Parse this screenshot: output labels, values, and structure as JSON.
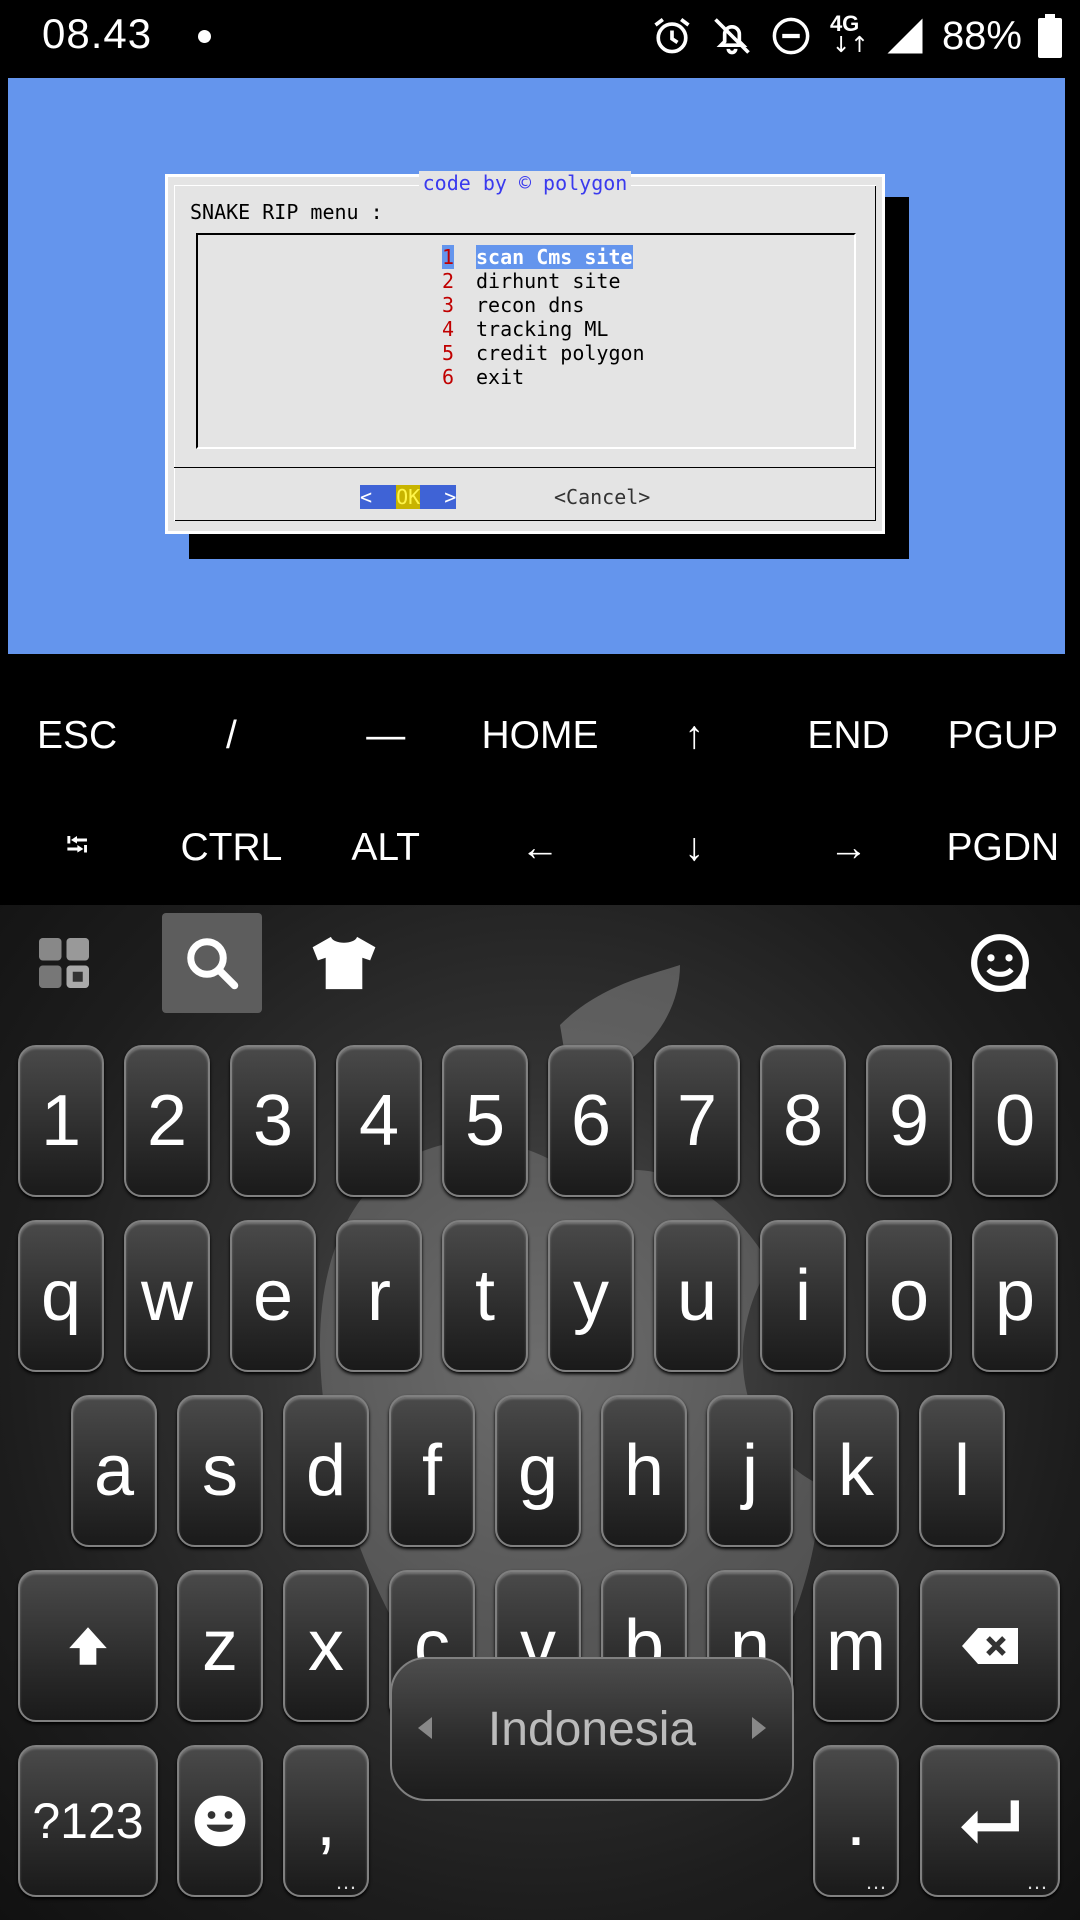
{
  "status_bar": {
    "time": "08.43",
    "network": "4G",
    "battery": "88%",
    "icons": [
      "notification-dot-icon",
      "alarm-icon",
      "notifications-off-icon",
      "do-not-disturb-icon",
      "network-4g-icon",
      "signal-icon",
      "battery-icon"
    ]
  },
  "terminal": {
    "background": "#6495ed",
    "dialog": {
      "title": "code by © polygon",
      "heading": "SNAKE RIP menu :",
      "items": [
        {
          "num": "1",
          "label": "scan Cms site",
          "selected": true
        },
        {
          "num": "2",
          "label": "dirhunt site"
        },
        {
          "num": "3",
          "label": "recon dns"
        },
        {
          "num": "4",
          "label": "tracking ML"
        },
        {
          "num": "5",
          "label": "credit polygon"
        },
        {
          "num": "6",
          "label": "exit"
        }
      ],
      "ok_left": "<  ",
      "ok_text": "OK",
      "ok_right": "  >",
      "cancel": "<Cancel>"
    }
  },
  "extra_keys": {
    "row1": [
      "ESC",
      "/",
      "—",
      "HOME",
      "↑",
      "END",
      "PGUP"
    ],
    "row2": [
      "⭾",
      "CTRL",
      "ALT",
      "←",
      "↓",
      "→",
      "PGDN"
    ]
  },
  "keyboard": {
    "toolbar": [
      "apps-grid-icon",
      "search-icon",
      "theme-shirt-icon",
      "sticker-face-icon"
    ],
    "number_row": [
      "1",
      "2",
      "3",
      "4",
      "5",
      "6",
      "7",
      "8",
      "9",
      "0"
    ],
    "row_q": [
      "q",
      "w",
      "e",
      "r",
      "t",
      "y",
      "u",
      "i",
      "o",
      "p"
    ],
    "row_a": [
      "a",
      "s",
      "d",
      "f",
      "g",
      "h",
      "j",
      "k",
      "l"
    ],
    "row_z": [
      "z",
      "x",
      "c",
      "v",
      "b",
      "n",
      "m"
    ],
    "symbols_key": "?123",
    "comma": ",",
    "period": ".",
    "space_label": "Indonesia"
  }
}
